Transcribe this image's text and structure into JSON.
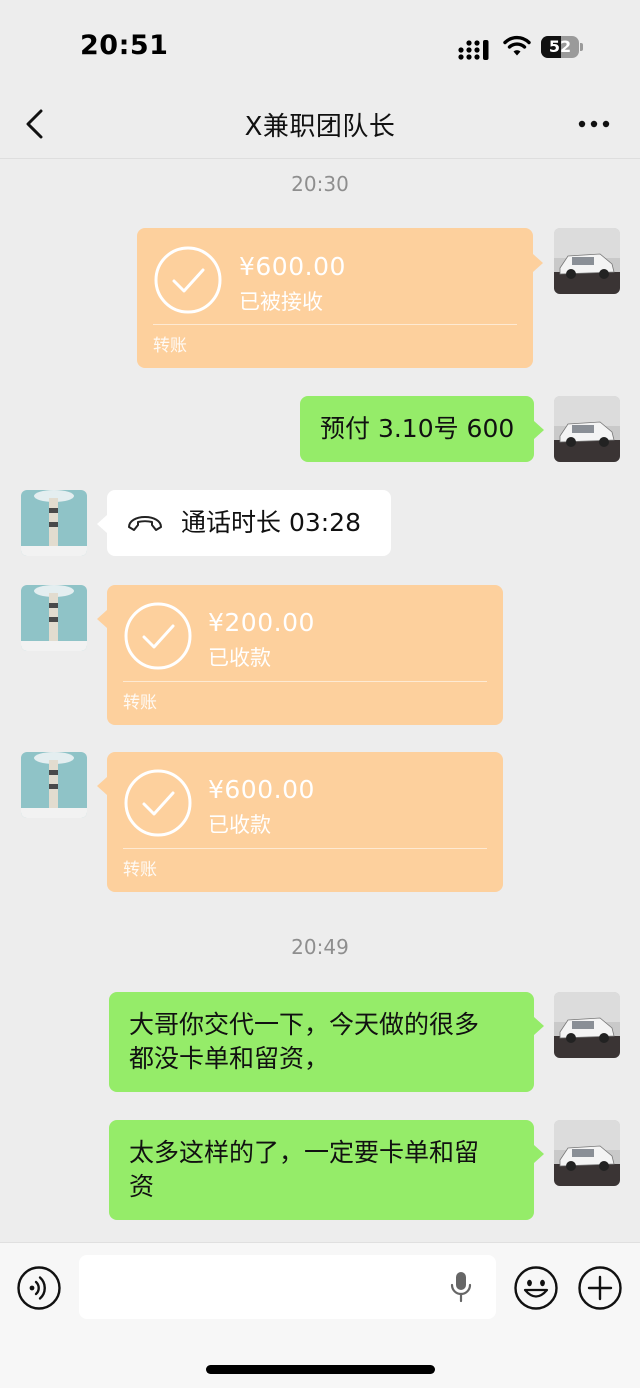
{
  "status_bar": {
    "time": "20:51",
    "battery": "52",
    "battery_level": 0.52
  },
  "header": {
    "title": "X兼职团队长"
  },
  "timestamps": [
    "20:30",
    "20:49"
  ],
  "messages": [
    {
      "kind": "transfer",
      "side": "right",
      "amount": "¥600.00",
      "status": "已被接收",
      "label": "转账"
    },
    {
      "kind": "text",
      "side": "right",
      "text": "预付 3.10号 600"
    },
    {
      "kind": "call",
      "side": "left",
      "text": "通话时长 03:28",
      "icon": "phone-hangup-icon"
    },
    {
      "kind": "transfer",
      "side": "left",
      "amount": "¥200.00",
      "status": "已收款",
      "label": "转账"
    },
    {
      "kind": "transfer",
      "side": "left",
      "amount": "¥600.00",
      "status": "已收款",
      "label": "转账"
    },
    {
      "kind": "text",
      "side": "right",
      "lines": [
        "大哥你交代一下，今天做的很多",
        "都没卡单和留资，"
      ]
    },
    {
      "kind": "text",
      "side": "right",
      "lines": [
        "太多这样的了，一定要卡单和留",
        "资"
      ]
    }
  ],
  "input": {
    "value": "",
    "placeholder": ""
  },
  "icons": {
    "back": "chevron-left-icon",
    "more": "more-dots-icon",
    "voice": "voice-icon",
    "mic": "mic-icon",
    "emoji": "emoji-icon",
    "plus": "plus-icon",
    "transfer_check": "check-circle-icon"
  },
  "colors": {
    "background": "#ededed",
    "bubble_green": "#95ec69",
    "bubble_white": "#ffffff",
    "transfer_orange": "#fdd09d",
    "timestamp": "#8e8e8e"
  }
}
